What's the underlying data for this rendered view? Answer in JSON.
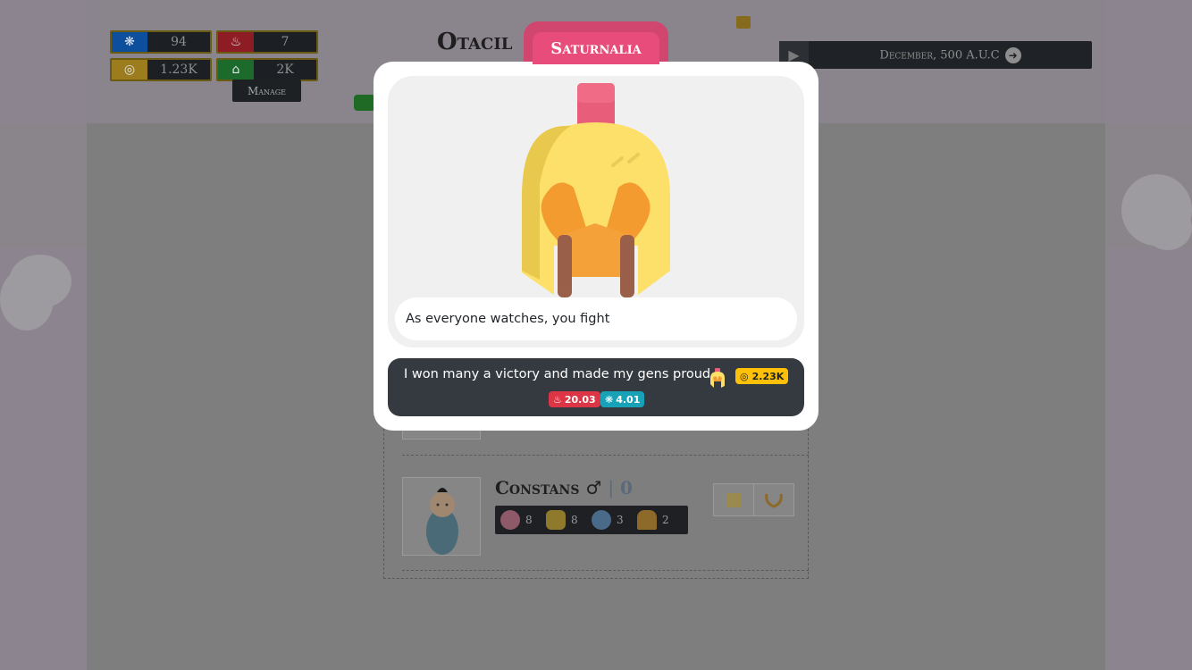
{
  "stats": {
    "piety": {
      "icon": "gear-icon",
      "value": "94"
    },
    "influence": {
      "icon": "flame-icon",
      "value": "7"
    },
    "coins": {
      "icon": "coins-icon",
      "value": "1.23K"
    },
    "estate": {
      "icon": "house-icon",
      "value": "2K"
    }
  },
  "manage_label": "Manage",
  "family_title": "Otacil",
  "date": {
    "label": "December, 500 A.U.C"
  },
  "heir": {
    "name": "Constans",
    "sex_symbol": "♂",
    "separator": "|",
    "number": "0"
  },
  "skills": [
    {
      "icon": "brain-icon",
      "value": "8"
    },
    {
      "icon": "coins-icon",
      "value": "8"
    },
    {
      "icon": "speech-icon",
      "value": "3"
    },
    {
      "icon": "helmet-icon",
      "value": "2"
    }
  ],
  "modal": {
    "title": "Saturnalia",
    "event_text": "As everyone watches, you fight",
    "choice": {
      "text": "I won many a victory and made my gens proud",
      "cost_badge": "2.23K",
      "influence_badge": "20.03",
      "piety_badge": "4.01"
    }
  },
  "colors": {
    "modal_accent": "#e84c7a",
    "choice_bg": "#343a40",
    "gold_badge": "#ffc107",
    "red_badge": "#dc3545",
    "teal_badge": "#17a2b8"
  }
}
